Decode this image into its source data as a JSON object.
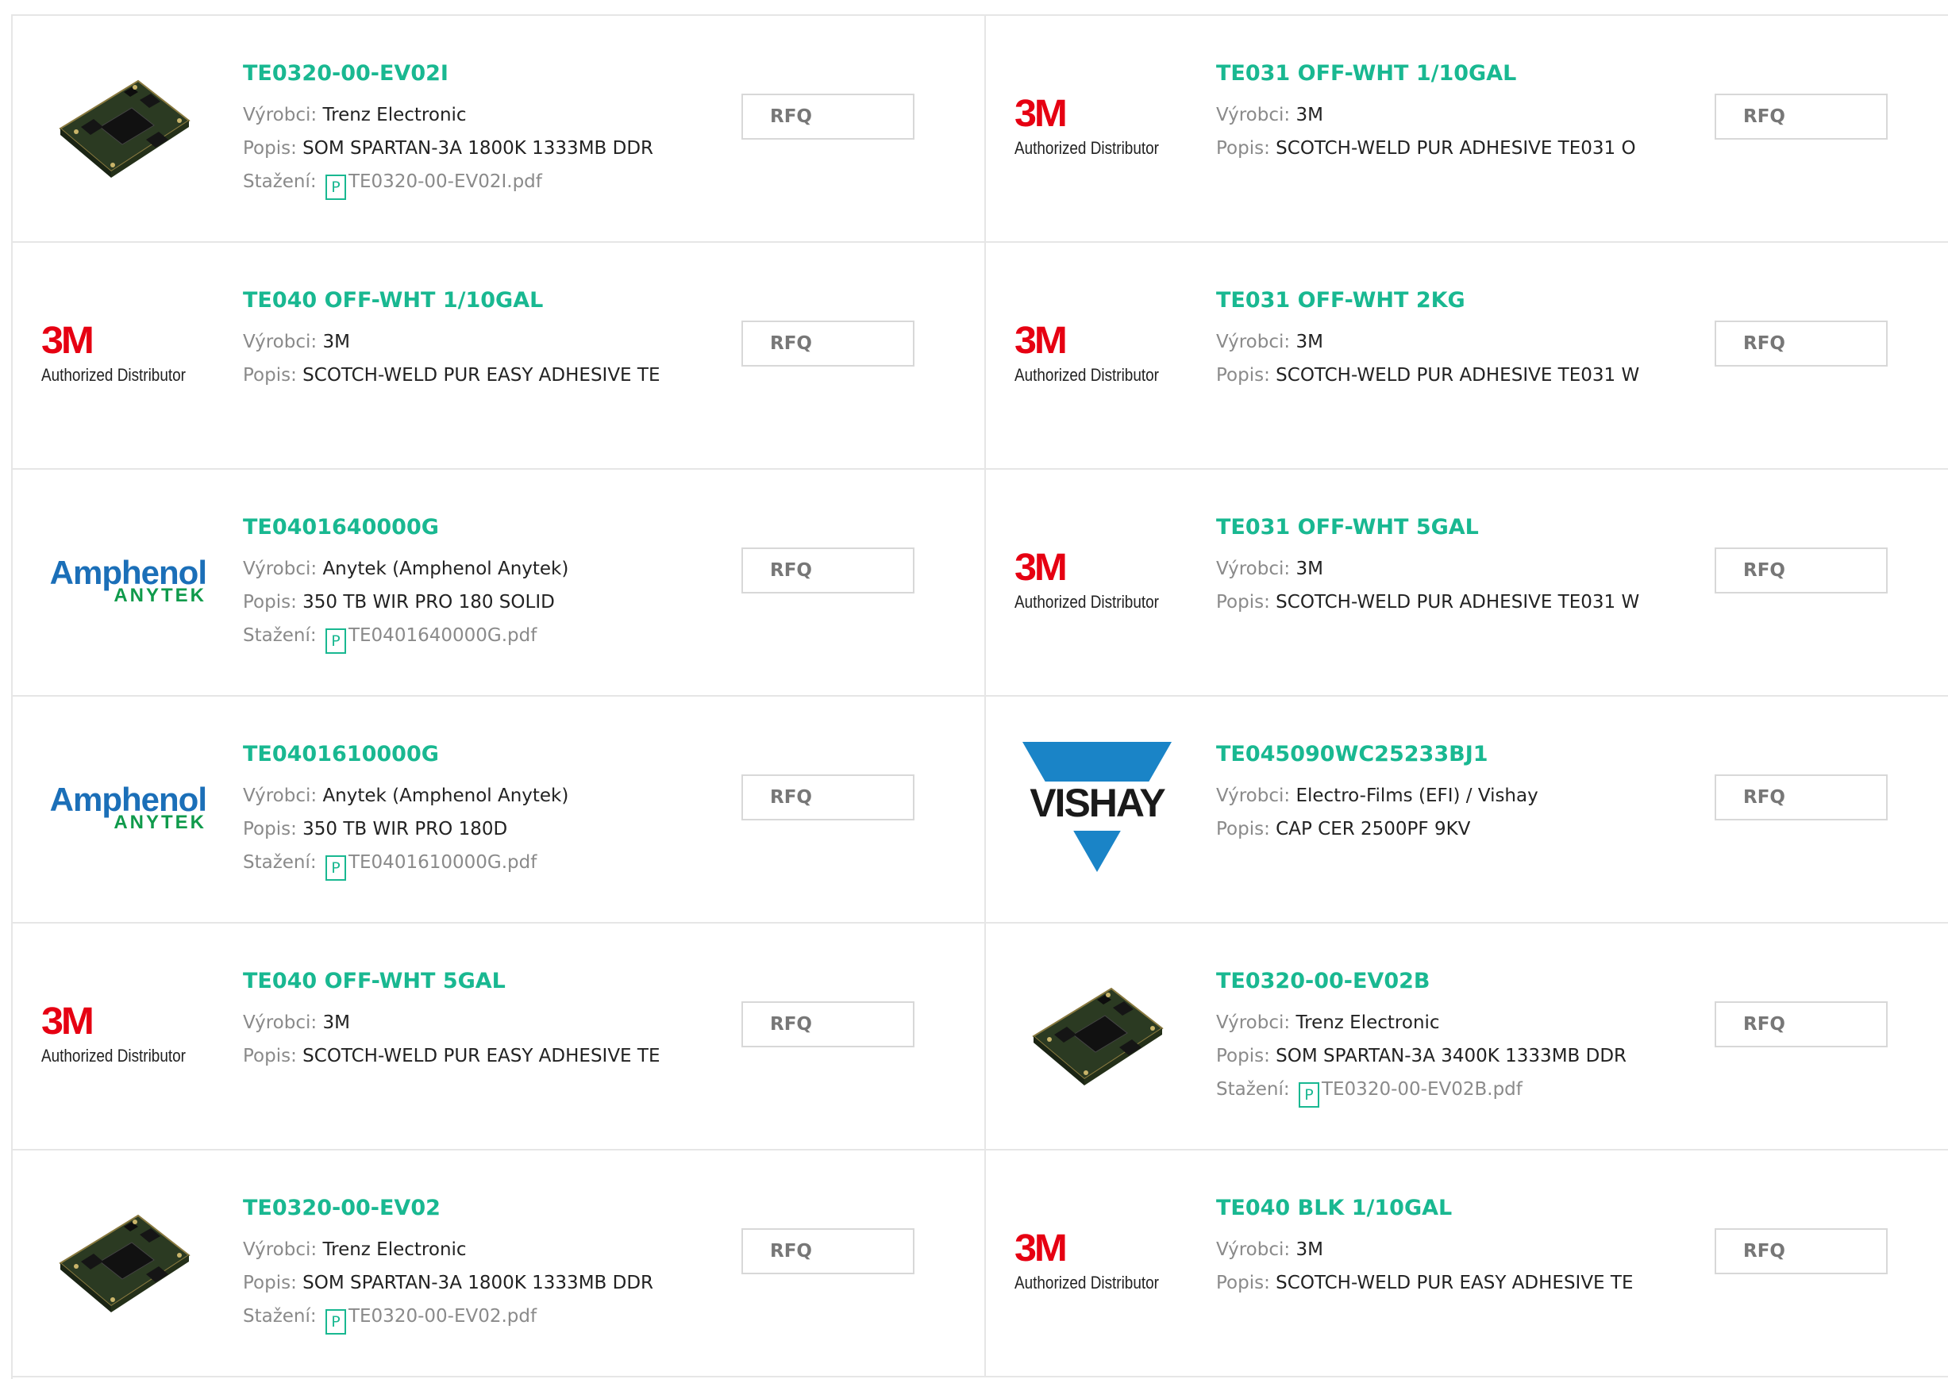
{
  "labels": {
    "vyrobci": "Výrobci:",
    "popis": "Popis:",
    "stazeni": "Stažení:",
    "pdf_glyph": "P"
  },
  "colors": {
    "accent": "#19b891",
    "brand_3m": "#e60012",
    "amphenol_blue": "#1b6fb8",
    "anytek_green": "#0f9a4b",
    "vishay_blue": "#1a84c7"
  },
  "products": [
    {
      "logo": "chip-board",
      "name": "TE0320-00-EV02I",
      "manufacturer": "Trenz Electronic",
      "description": "SOM SPARTAN-3A 1800K 1333MB DDR",
      "download": "TE0320-00-EV02I.pdf",
      "button": "RFQ"
    },
    {
      "logo": "3m",
      "name": "TE031 OFF-WHT 1/10GAL",
      "manufacturer": "3M",
      "description": "SCOTCH-WELD PUR ADHESIVE TE031 O",
      "download": null,
      "button": "RFQ"
    },
    {
      "logo": "3m",
      "name": "TE040 OFF-WHT 1/10GAL",
      "manufacturer": "3M",
      "description": "SCOTCH-WELD PUR EASY ADHESIVE TE",
      "download": null,
      "button": "RFQ"
    },
    {
      "logo": "3m",
      "name": "TE031 OFF-WHT 2KG",
      "manufacturer": "3M",
      "description": "SCOTCH-WELD PUR ADHESIVE TE031 W",
      "download": null,
      "button": "RFQ"
    },
    {
      "logo": "amphenol",
      "name": "TE0401640000G",
      "manufacturer": "Anytek (Amphenol Anytek)",
      "description": "350 TB WIR PRO 180 SOLID",
      "download": "TE0401640000G.pdf",
      "button": "RFQ"
    },
    {
      "logo": "3m",
      "name": "TE031 OFF-WHT 5GAL",
      "manufacturer": "3M",
      "description": "SCOTCH-WELD PUR ADHESIVE TE031 W",
      "download": null,
      "button": "RFQ"
    },
    {
      "logo": "amphenol",
      "name": "TE0401610000G",
      "manufacturer": "Anytek (Amphenol Anytek)",
      "description": "350 TB WIR PRO 180D",
      "download": "TE0401610000G.pdf",
      "button": "RFQ"
    },
    {
      "logo": "vishay",
      "name": "TE045090WC25233BJ1",
      "manufacturer": "Electro-Films (EFI) / Vishay",
      "description": "CAP CER 2500PF 9KV",
      "download": null,
      "button": "RFQ"
    },
    {
      "logo": "3m",
      "name": "TE040 OFF-WHT 5GAL",
      "manufacturer": "3M",
      "description": "SCOTCH-WELD PUR EASY ADHESIVE TE",
      "download": null,
      "button": "RFQ"
    },
    {
      "logo": "chip-board",
      "name": "TE0320-00-EV02B",
      "manufacturer": "Trenz Electronic",
      "description": "SOM SPARTAN-3A 3400K 1333MB DDR",
      "download": "TE0320-00-EV02B.pdf",
      "button": "RFQ"
    },
    {
      "logo": "chip-board",
      "name": "TE0320-00-EV02",
      "manufacturer": "Trenz Electronic",
      "description": "SOM SPARTAN-3A 1800K 1333MB DDR",
      "download": "TE0320-00-EV02.pdf",
      "button": "RFQ"
    },
    {
      "logo": "3m",
      "name": "TE040 BLK 1/10GAL",
      "manufacturer": "3M",
      "description": "SCOTCH-WELD PUR EASY ADHESIVE TE",
      "download": null,
      "button": "RFQ"
    }
  ],
  "logo_text": {
    "m3_mark": "3M",
    "m3_sub": "Authorized Distributor",
    "amphenol_main": "Amphenol",
    "amphenol_sub": "ANYTEK",
    "vishay": "VISHAY"
  }
}
